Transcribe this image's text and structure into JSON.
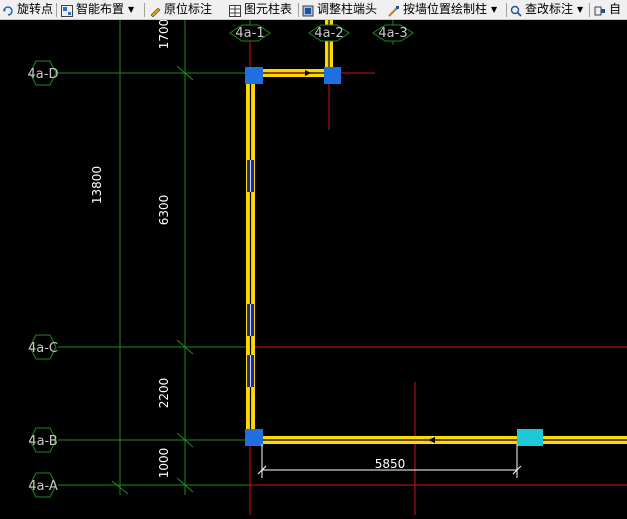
{
  "toolbar": {
    "rotate_point": "旋转点",
    "smart_layout": "智能布置",
    "origin_annotation": "原位标注",
    "element_column_table": "图元柱表",
    "adjust_column_end": "调整柱端头",
    "draw_by_wall": "按墙位置绘制柱",
    "check_annotation": "查改标注",
    "auto": "自"
  },
  "axes": {
    "top_1": "4a-1",
    "top_2": "4a-2",
    "top_3": "4a-3",
    "left_D": "4a-D",
    "left_C": "4a-C",
    "left_B": "4a-B",
    "left_A": "4a-A"
  },
  "dimensions": {
    "total": "13800",
    "d1": "1700",
    "d2": "6300",
    "d3": "2200",
    "d4": "1000",
    "bottom": "5850"
  },
  "colors": {
    "background": "#000000",
    "grid_green": "#1e8c1e",
    "axis_red": "#c81414",
    "beam_yellow": "#ffd700",
    "column_blue": "#1f6fe0",
    "column_cyan": "#1ec8d8",
    "dim_white": "#ffffff"
  }
}
